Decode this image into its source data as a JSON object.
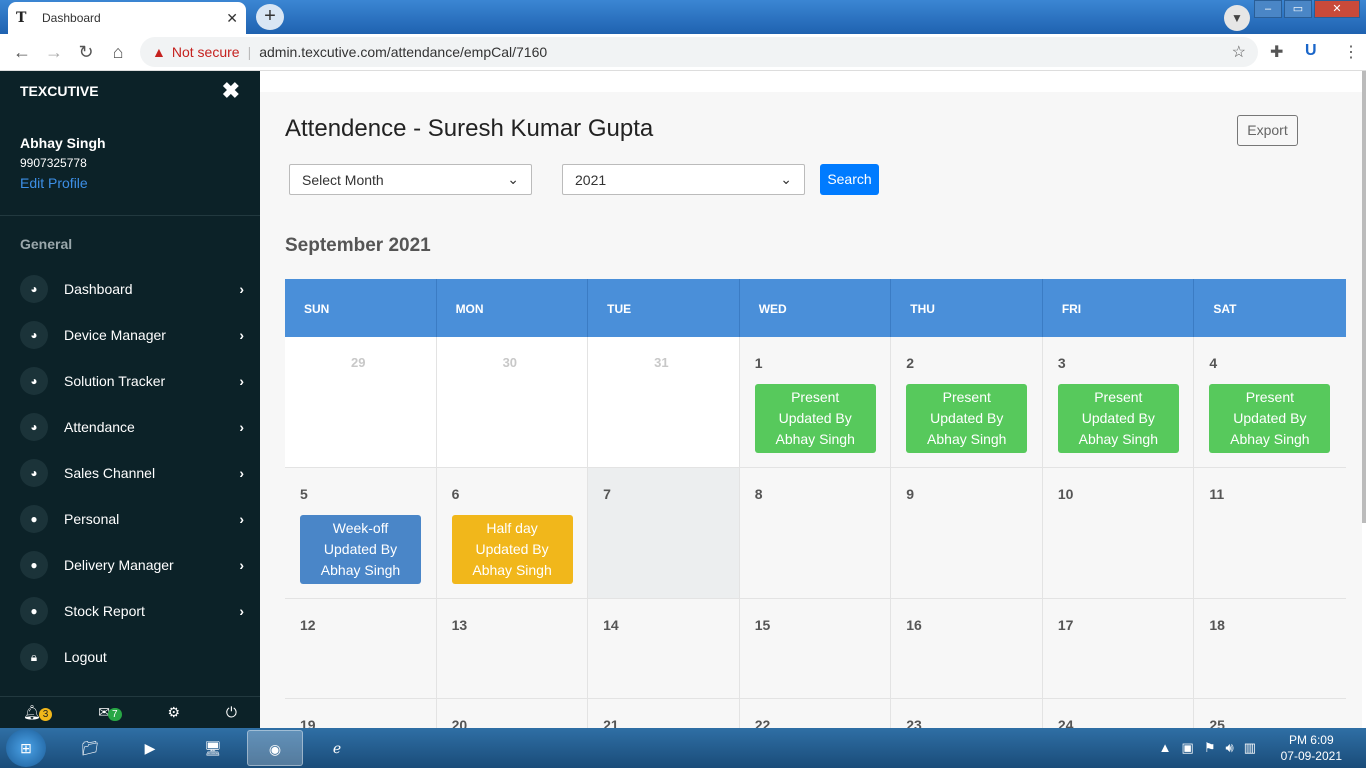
{
  "browser": {
    "tab_title": "Dashboard",
    "tab_close": "✕",
    "new_tab": "+",
    "not_secure": "Not secure",
    "url": "admin.texcutive.com/attendance/empCal/7160"
  },
  "sidebar": {
    "brand": "TEXCUTIVE",
    "close_glyph": "✖",
    "user_name": "Abhay Singh",
    "user_phone": "9907325778",
    "edit_profile": "Edit Profile",
    "section": "General",
    "items": [
      {
        "label": "Dashboard",
        "icon": "gauge-icon"
      },
      {
        "label": "Device Manager",
        "icon": "gauge-icon"
      },
      {
        "label": "Solution Tracker",
        "icon": "gauge-icon"
      },
      {
        "label": "Attendance",
        "icon": "gauge-icon"
      },
      {
        "label": "Sales Channel",
        "icon": "gauge-icon"
      },
      {
        "label": "Personal",
        "icon": "user-icon"
      },
      {
        "label": "Delivery Manager",
        "icon": "user-icon"
      },
      {
        "label": "Stock Report",
        "icon": "user-icon"
      },
      {
        "label": "Logout",
        "icon": "lock-icon"
      }
    ],
    "footer": {
      "notifications_count": "3",
      "messages_count": "7"
    }
  },
  "main": {
    "title": "Attendence - Suresh Kumar Gupta",
    "export_label": "Export",
    "month_select": "Select Month",
    "year_select": "2021",
    "search_label": "Search",
    "month_title": "September 2021"
  },
  "calendar": {
    "headers": [
      "SUN",
      "MON",
      "TUE",
      "WED",
      "THU",
      "FRI",
      "SAT"
    ],
    "week1": {
      "d0": "29",
      "d1": "30",
      "d2": "31",
      "d3": "1",
      "d4": "2",
      "d5": "3",
      "d6": "4"
    },
    "week2": {
      "d0": "5",
      "d1": "6",
      "d2": "7",
      "d3": "8",
      "d4": "9",
      "d5": "10",
      "d6": "11"
    },
    "week3": {
      "d0": "12",
      "d1": "13",
      "d2": "14",
      "d3": "15",
      "d4": "16",
      "d5": "17",
      "d6": "18"
    },
    "week4": {
      "d0": "19",
      "d1": "20",
      "d2": "21",
      "d3": "22",
      "d4": "23",
      "d5": "24",
      "d6": "25"
    },
    "events": {
      "present": "Present",
      "weekoff": "Week-off",
      "halfday": "Half day",
      "updated_by": "Updated By",
      "updater": "Abhay Singh"
    },
    "colors": {
      "present": "#57c95c",
      "weekoff": "#4a86c8",
      "halfday": "#f1b71b",
      "header": "#4a8fd9"
    }
  },
  "taskbar": {
    "time": "PM 6:09",
    "date": "07-09-2021"
  }
}
